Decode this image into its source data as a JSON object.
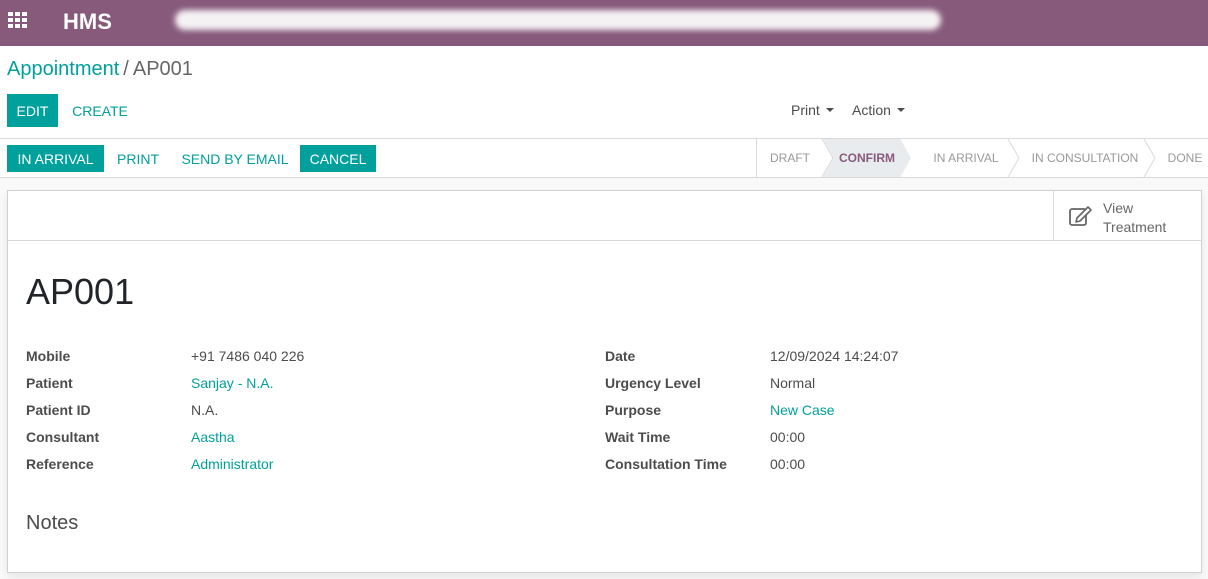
{
  "topbar": {
    "app_title": "HMS",
    "apps_icon": "grid-icon"
  },
  "breadcrumb": {
    "parent": "Appointment",
    "separator": "/",
    "current": "AP001"
  },
  "actions": {
    "edit": "EDIT",
    "create": "CREATE",
    "print": "Print",
    "action": "Action"
  },
  "header_buttons": {
    "in_arrival": "IN ARRIVAL",
    "print": "PRINT",
    "send_by_email": "SEND BY EMAIL",
    "cancel": "CANCEL"
  },
  "stages": [
    {
      "label": "DRAFT",
      "active": false
    },
    {
      "label": "CONFIRM",
      "active": true
    },
    {
      "label": "IN ARRIVAL",
      "active": false
    },
    {
      "label": "IN CONSULTATION",
      "active": false
    },
    {
      "label": "DONE",
      "active": false
    }
  ],
  "smart_button": {
    "icon": "edit-icon",
    "line1": "View",
    "line2": "Treatment"
  },
  "record": {
    "name": "AP001"
  },
  "left_fields": [
    {
      "label": "Mobile",
      "value": "+91 7486 040 226",
      "link": false
    },
    {
      "label": "Patient",
      "value": "Sanjay - N.A.",
      "link": true
    },
    {
      "label": "Patient ID",
      "value": "N.A.",
      "link": false
    },
    {
      "label": "Consultant",
      "value": "Aastha",
      "link": true
    },
    {
      "label": "Reference",
      "value": "Administrator",
      "link": true
    }
  ],
  "right_fields": [
    {
      "label": "Date",
      "value": "12/09/2024 14:24:07",
      "link": false
    },
    {
      "label": "Urgency Level",
      "value": "Normal",
      "link": false
    },
    {
      "label": "Purpose",
      "value": "New Case",
      "link": true
    },
    {
      "label": "Wait Time",
      "value": "00:00",
      "link": false
    },
    {
      "label": "Consultation Time",
      "value": "00:00",
      "link": false
    }
  ],
  "notes": {
    "title": "Notes"
  },
  "colors": {
    "brand": "#875a7b",
    "accent": "#00a09d"
  }
}
